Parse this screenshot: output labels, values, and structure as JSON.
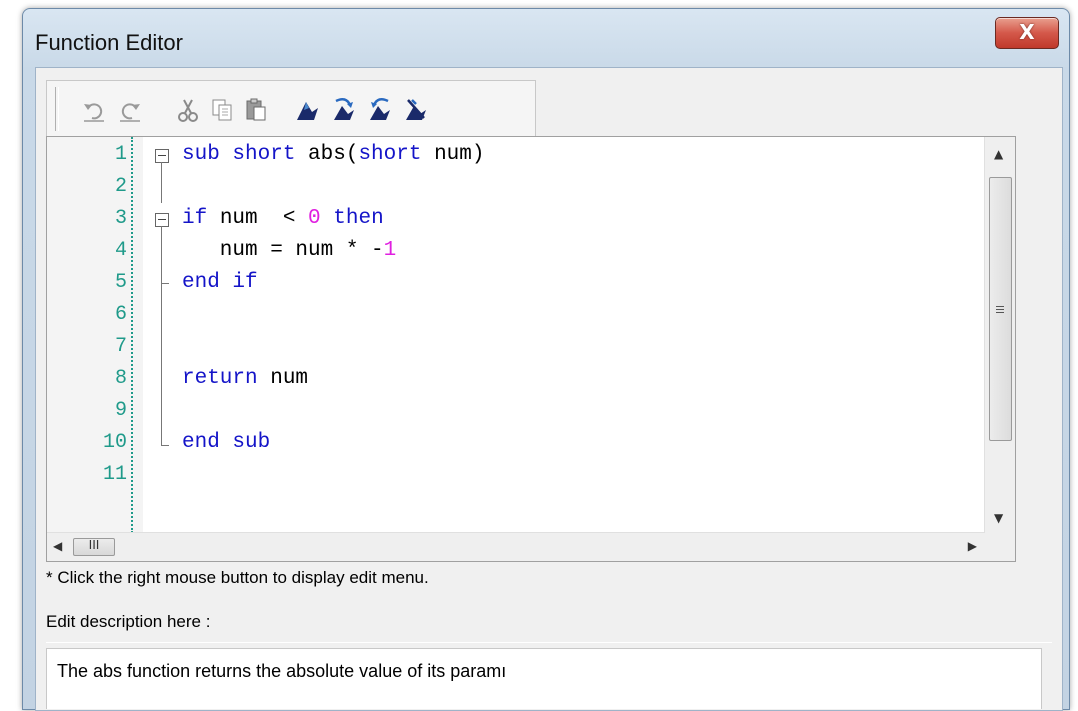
{
  "window": {
    "title": "Function Editor",
    "close_glyph": "X"
  },
  "toolbar": {
    "buttons": [
      {
        "name": "undo-icon"
      },
      {
        "name": "redo-icon"
      },
      {
        "name": "cut-icon"
      },
      {
        "name": "copy-icon"
      },
      {
        "name": "paste-icon"
      },
      {
        "name": "toggle-bookmark-icon"
      },
      {
        "name": "next-bookmark-icon"
      },
      {
        "name": "previous-bookmark-icon"
      },
      {
        "name": "clear-bookmarks-icon"
      }
    ]
  },
  "editor": {
    "line_numbers": [
      "1",
      "2",
      "3",
      "4",
      "5",
      "6",
      "7",
      "8",
      "9",
      "10",
      "11"
    ],
    "scroll_glyph": "III",
    "code": {
      "l1_kw1": "sub",
      "l1_kw2": "short",
      "l1_mid": " abs(",
      "l1_kw3": "short",
      "l1_end": " num)",
      "l3_kw1": "if",
      "l3_mid": " num  < ",
      "l3_num": "0",
      "l3_kw2": "then",
      "l4_pre": "   num = num * -",
      "l4_num": "1",
      "l5_kw": "end if",
      "l8_kw": "return",
      "l8_end": " num",
      "l10_kw": "end sub"
    }
  },
  "hint_text": "* Click the right mouse button to display edit menu.",
  "description": {
    "label": "Edit description here :",
    "value": "The abs function returns the absolute value of its paramı"
  },
  "colors": {
    "keyword": "#1414c8",
    "number": "#e020e0",
    "line_number": "#1f9a8a"
  }
}
